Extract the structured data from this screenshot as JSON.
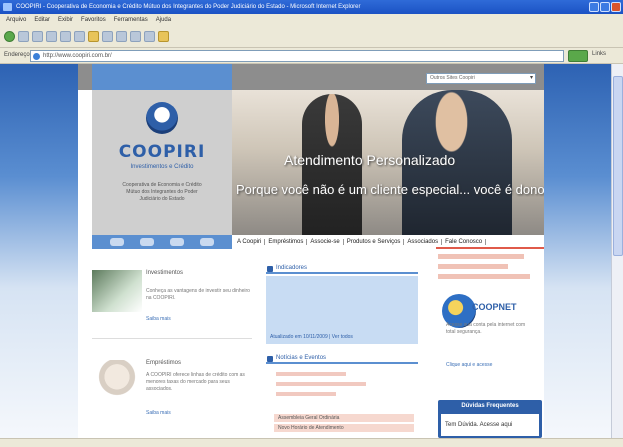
{
  "window": {
    "title": "COOPIRI - Cooperativa de Economia e Crédito Mútuo dos Integrantes do Poder Judiciário do Estado - Microsoft Internet Explorer"
  },
  "menu": [
    "Arquivo",
    "Editar",
    "Exibir",
    "Favoritos",
    "Ferramentas",
    "Ajuda"
  ],
  "address": {
    "label": "Endereço",
    "url": "http://www.coopiri.com.br/",
    "links_label": "Links"
  },
  "site": {
    "select_placeholder": "Outros Sites Coopiri",
    "logo": {
      "name": "COOPIRI",
      "subtitle": "Investimentos e Crédito",
      "description": "Cooperativa de Economia e Crédito Mútuo dos Integrantes do Poder Judiciário do Estado"
    },
    "banner": {
      "title": "Atendimento Personalizado",
      "subtitle": "Porque você não é um cliente especial... você é dono."
    },
    "nav": [
      "A Coopiri",
      "Empréstimos",
      "Associe-se",
      "Produtos e Serviços",
      "Associados",
      "Fale Conosco"
    ],
    "news": [
      {
        "title": "Investimentos",
        "text": "Conheça as vantagens de investir seu dinheiro na COOPIRI.",
        "link": "Saiba mais"
      },
      {
        "title": "Empréstimos",
        "text": "A COOPIRI oferece linhas de crédito com as menores taxas do mercado para seus associados.",
        "link": "Saiba mais"
      }
    ],
    "middle": {
      "box1_title": "Indicadores",
      "box1_footer": "Atualizado em 10/11/2009 | Ver todos",
      "box2_title": "Notícias e Eventos",
      "rows": [
        "Assembleia Geral Ordinária",
        "Novo Horário de Atendimento"
      ]
    },
    "coopnet": {
      "name": "COOPNET",
      "description": "Acesse sua conta pela internet com total segurança.",
      "footer": "Clique aqui e acesse"
    },
    "duvidas": {
      "title": "Dúvidas Frequentes",
      "body": "Tem Dúvida. Acesse aqui"
    }
  }
}
